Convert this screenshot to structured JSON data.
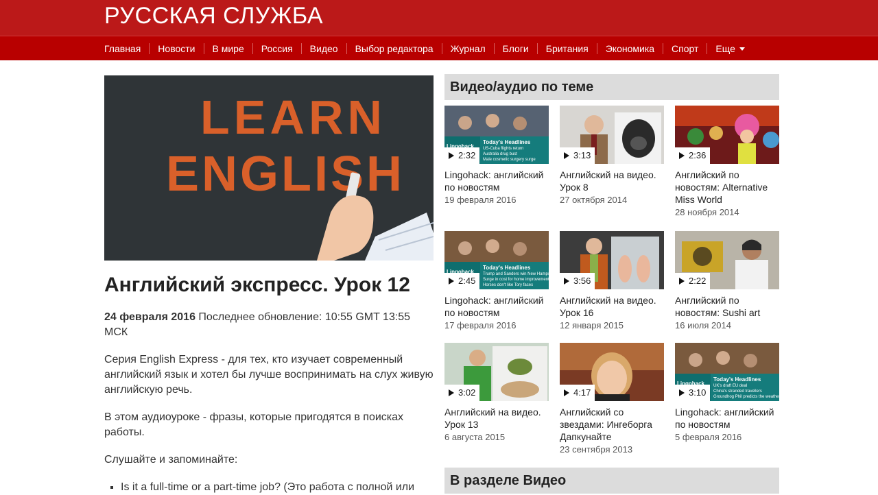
{
  "header": {
    "logo": "РУССКАЯ СЛУЖБА"
  },
  "nav": {
    "items": [
      "Главная",
      "Новости",
      "В мире",
      "Россия",
      "Видео",
      "Выбор редактора",
      "Журнал",
      "Блоги",
      "Британия",
      "Экономика",
      "Спорт"
    ],
    "more_label": "Еще"
  },
  "article": {
    "hero_text_1": "LEARN",
    "hero_text_2": "ENGLISH",
    "title": "Английский экспресс. Урок 12",
    "date": "24 февраля 2016",
    "updated": " Последнее обновление: 10:55 GMT 13:55 МСК",
    "para1": "Серия English Express - для тех, кто изучает современный английский язык и хотел бы лучше воспринимать на слух живую английскую речь.",
    "para2": "В этом аудиоуроке - фразы, которые пригодятся в поисках работы.",
    "para3": "Слушайте и запоминайте:",
    "bullets": [
      "Is it a full-time or a part-time job? (Это работа с полной или"
    ]
  },
  "side": {
    "section_title": "Видео/аудио по теме",
    "section2_title": "В разделе Видео",
    "cards": [
      {
        "duration": "2:32",
        "title": "Lingohack: английский по новостям",
        "date": "19 февраля 2016",
        "thumb": "lingohack",
        "headlines": [
          "Today's Headlines",
          "US-Cuba flights return",
          "Australia drug bust",
          "Male cosmetic surgery surge"
        ]
      },
      {
        "duration": "3:13",
        "title": "Английский на видео. Урок 8",
        "date": "27 октября 2014",
        "thumb": "gorilla"
      },
      {
        "duration": "2:36",
        "title": "Английский по новостям: Alternative Miss World",
        "date": "28 ноября 2014",
        "thumb": "carnival"
      },
      {
        "duration": "2:45",
        "title": "Lingohack: английский по новостям",
        "date": "17 февраля 2016",
        "thumb": "lingohack2",
        "headlines": [
          "Today's Headlines",
          "Trump and Sanders win New Hampshire",
          "Surge in cost for home improvement",
          "Horses don't like Tory faces"
        ]
      },
      {
        "duration": "3:56",
        "title": "Английский на видео. Урок 16",
        "date": "12 января 2015",
        "thumb": "feet"
      },
      {
        "duration": "2:22",
        "title": "Английский по новостям: Sushi art",
        "date": "16 июля 2014",
        "thumb": "sushi"
      },
      {
        "duration": "3:02",
        "title": "Английский на видео. Урок 13",
        "date": "6 августа 2015",
        "thumb": "potato"
      },
      {
        "duration": "4:17",
        "title": "Английский со звездами: Ингеборга Дапкунайте",
        "date": "23 сентября 2013",
        "thumb": "woman"
      },
      {
        "duration": "3:10",
        "title": "Lingohack: английский по новостям",
        "date": "5 февраля 2016",
        "thumb": "lingohack3",
        "headlines": [
          "Today's Headlines",
          "UK's draft EU deal",
          "China's stranded travellers",
          "Groundhog Phil predicts the weather"
        ]
      }
    ]
  },
  "colors": {
    "brand": "#bb1919",
    "nav": "#b80000",
    "hero_bg": "#2f3437",
    "hero_text": "#d9602a",
    "section_bg": "#dcdcdc"
  }
}
